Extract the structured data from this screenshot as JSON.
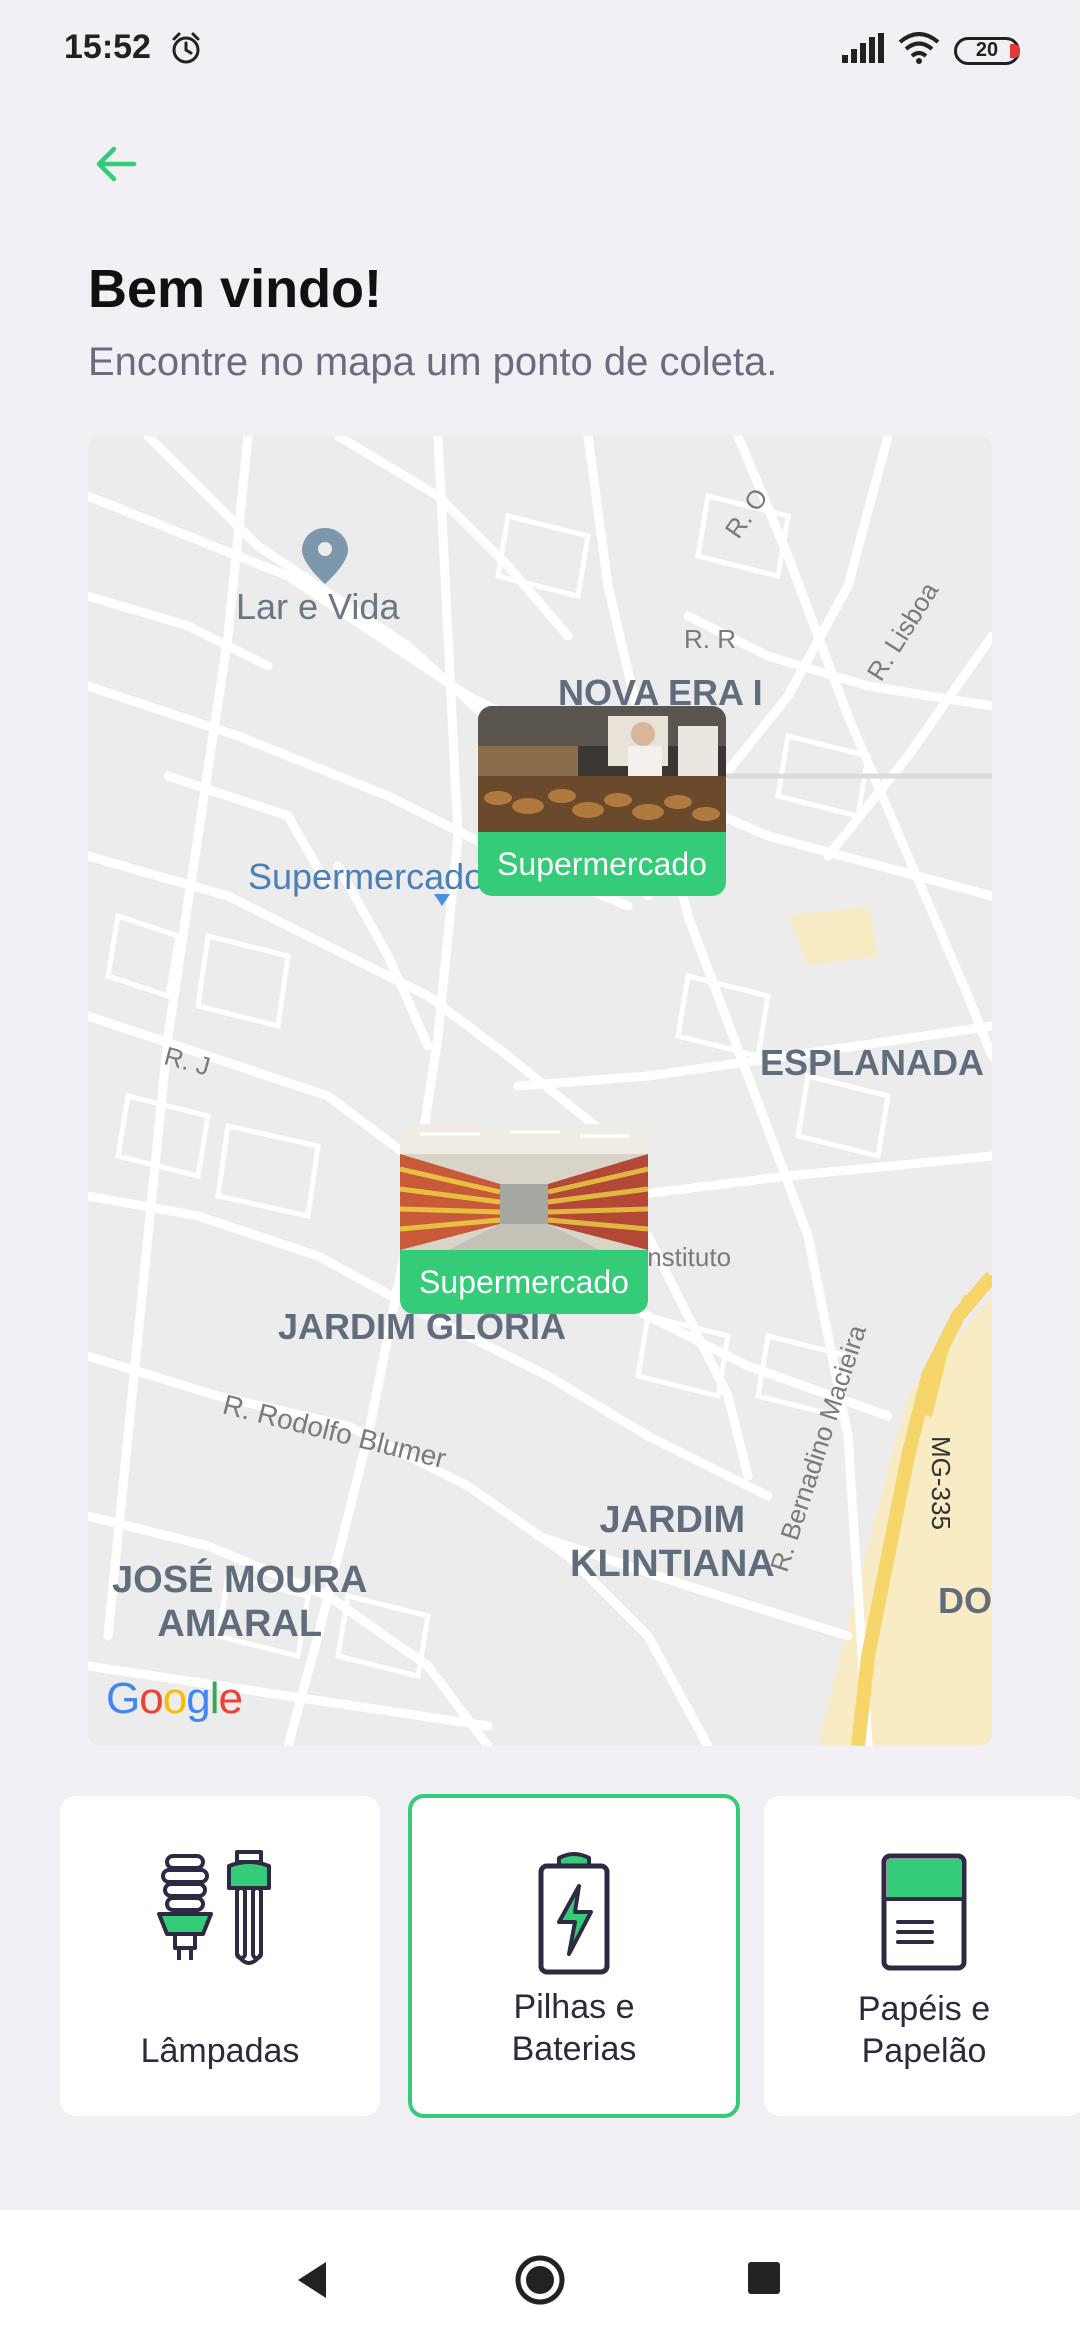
{
  "status_bar": {
    "time": "15:52",
    "battery_level": "20",
    "icons": [
      "alarm-icon",
      "signal-icon",
      "wifi-icon",
      "battery-icon"
    ]
  },
  "header": {
    "back_icon": "arrow-left-icon",
    "title": "Bem vindo!",
    "subtitle": "Encontre no mapa um ponto de coleta."
  },
  "map": {
    "poi_labels": [
      "Lar e Vida",
      "Supermercado"
    ],
    "neighborhood_labels": [
      "NOVA ERA I",
      "ESPLANADA",
      "JARDIM GLORIA",
      "JARDIM\nKLINTIANA",
      "JOSÉ MOURA\nAMARAL",
      "DO"
    ],
    "street_labels": [
      "R. O",
      "R. R",
      "R. Lisboa",
      "R. J",
      "R. Rodolfo Blumer",
      "Instituto",
      "R. Bernadino Macieira",
      "MG-335"
    ],
    "markers": [
      {
        "label": "Supermercado",
        "image": "bakery-photo"
      },
      {
        "label": "Supermercado",
        "image": "supermarket-aisle-photo"
      }
    ],
    "attribution": "Google"
  },
  "categories": [
    {
      "label": "Lâmpadas",
      "icon": "lamps-icon",
      "selected": false
    },
    {
      "label": "Pilhas e\nBaterias",
      "icon": "battery-charge-icon",
      "selected": true
    },
    {
      "label": "Papéis e\nPapelão",
      "icon": "paper-icon",
      "selected": false
    }
  ],
  "nav_bar": {
    "buttons": [
      "back-nav-icon",
      "home-nav-icon",
      "recents-nav-icon"
    ]
  },
  "colors": {
    "accent": "#34cb79",
    "title": "#111111",
    "subtitle": "#6c6c80",
    "background": "#f0f0f5"
  }
}
